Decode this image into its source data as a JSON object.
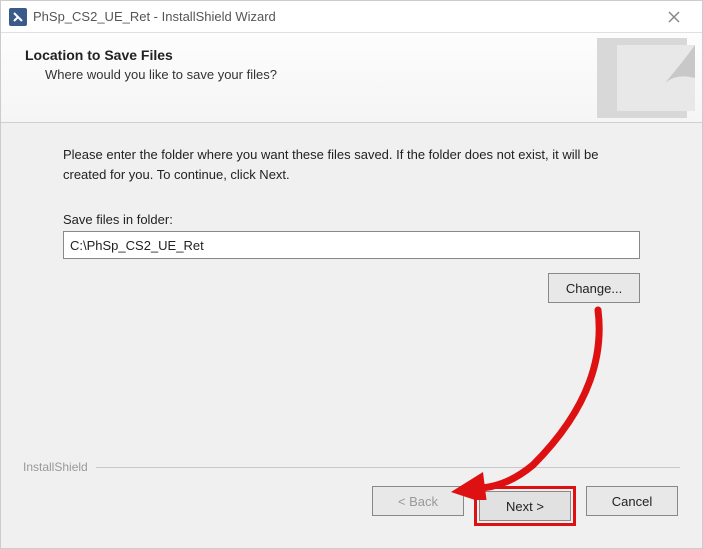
{
  "window": {
    "title": "PhSp_CS2_UE_Ret - InstallShield Wizard"
  },
  "header": {
    "title": "Location to Save Files",
    "subtitle": "Where would you like to save your files?"
  },
  "content": {
    "instruction": "Please enter the folder where you want these files saved.  If the folder does not exist, it will be created for you.   To continue, click Next.",
    "field_label": "Save files in folder:",
    "path_value": "C:\\PhSp_CS2_UE_Ret",
    "change_label": "Change..."
  },
  "footer": {
    "brand": "InstallShield",
    "back_label": "< Back",
    "next_label": "Next >",
    "cancel_label": "Cancel"
  }
}
